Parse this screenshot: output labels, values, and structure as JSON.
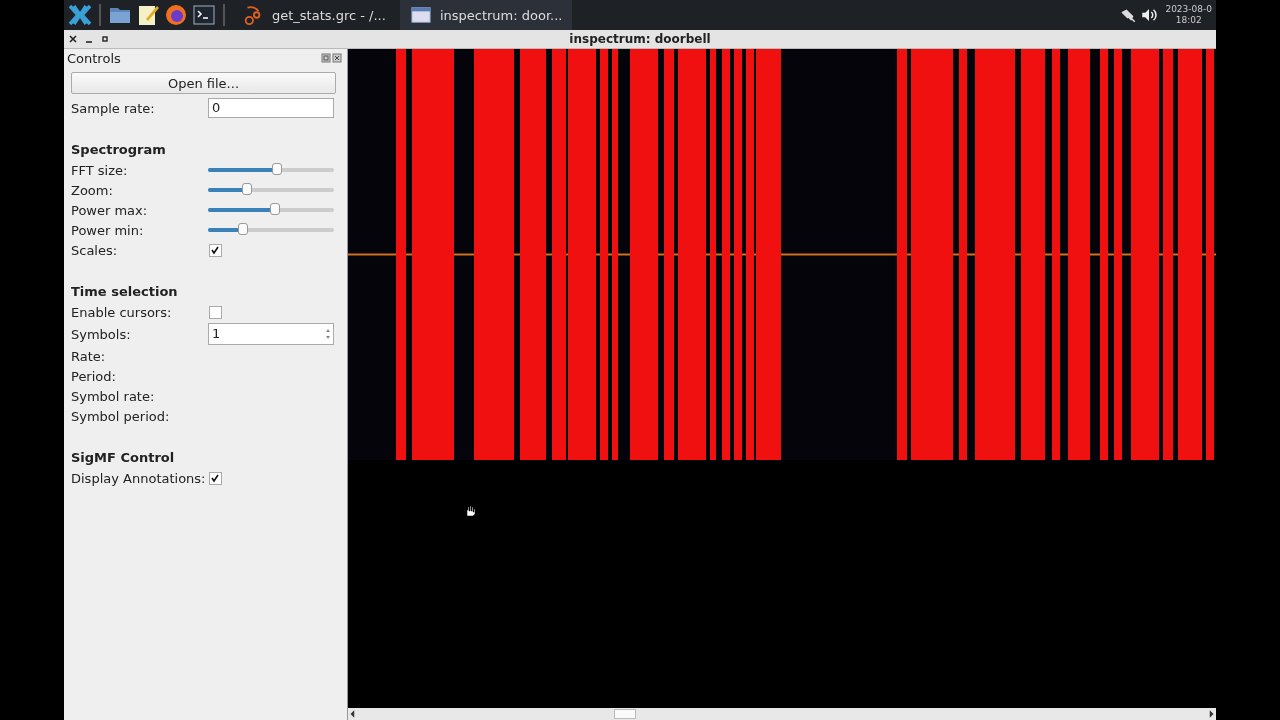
{
  "taskbar": {
    "tasks": [
      {
        "label": "get_stats.grc - /...",
        "selected": false
      },
      {
        "label": "inspectrum: door...",
        "selected": true
      }
    ],
    "clock": {
      "date": "2023-08-0",
      "time": "18:02"
    }
  },
  "window": {
    "title": "inspectrum: doorbell"
  },
  "panel": {
    "title": "Controls",
    "rows": [
      {
        "kind": "button",
        "label": "Open file..."
      },
      {
        "kind": "field",
        "label": "Sample rate:",
        "value": "0"
      },
      {
        "kind": "heading",
        "label": "Spectrogram"
      },
      {
        "kind": "slider",
        "label": "FFT size:",
        "level": 0.55
      },
      {
        "kind": "slider",
        "label": "Zoom:",
        "level": 0.31
      },
      {
        "kind": "slider",
        "label": "Power max:",
        "level": 0.53
      },
      {
        "kind": "slider",
        "label": "Power min:",
        "level": 0.28
      },
      {
        "kind": "checkbox",
        "label": "Scales:",
        "checked": true
      },
      {
        "kind": "heading",
        "label": "Time selection"
      },
      {
        "kind": "checkbox",
        "label": "Enable cursors:",
        "checked": false
      },
      {
        "kind": "spinbox",
        "label": "Symbols:",
        "value": "1"
      },
      {
        "kind": "label",
        "label": "Rate:"
      },
      {
        "kind": "label",
        "label": "Period:"
      },
      {
        "kind": "label",
        "label": "Symbol rate:"
      },
      {
        "kind": "label",
        "label": "Symbol period:"
      },
      {
        "kind": "heading",
        "label": "SigMF Control"
      },
      {
        "kind": "checkbox",
        "label": "Display Annotations:",
        "checked": true
      }
    ]
  }
}
